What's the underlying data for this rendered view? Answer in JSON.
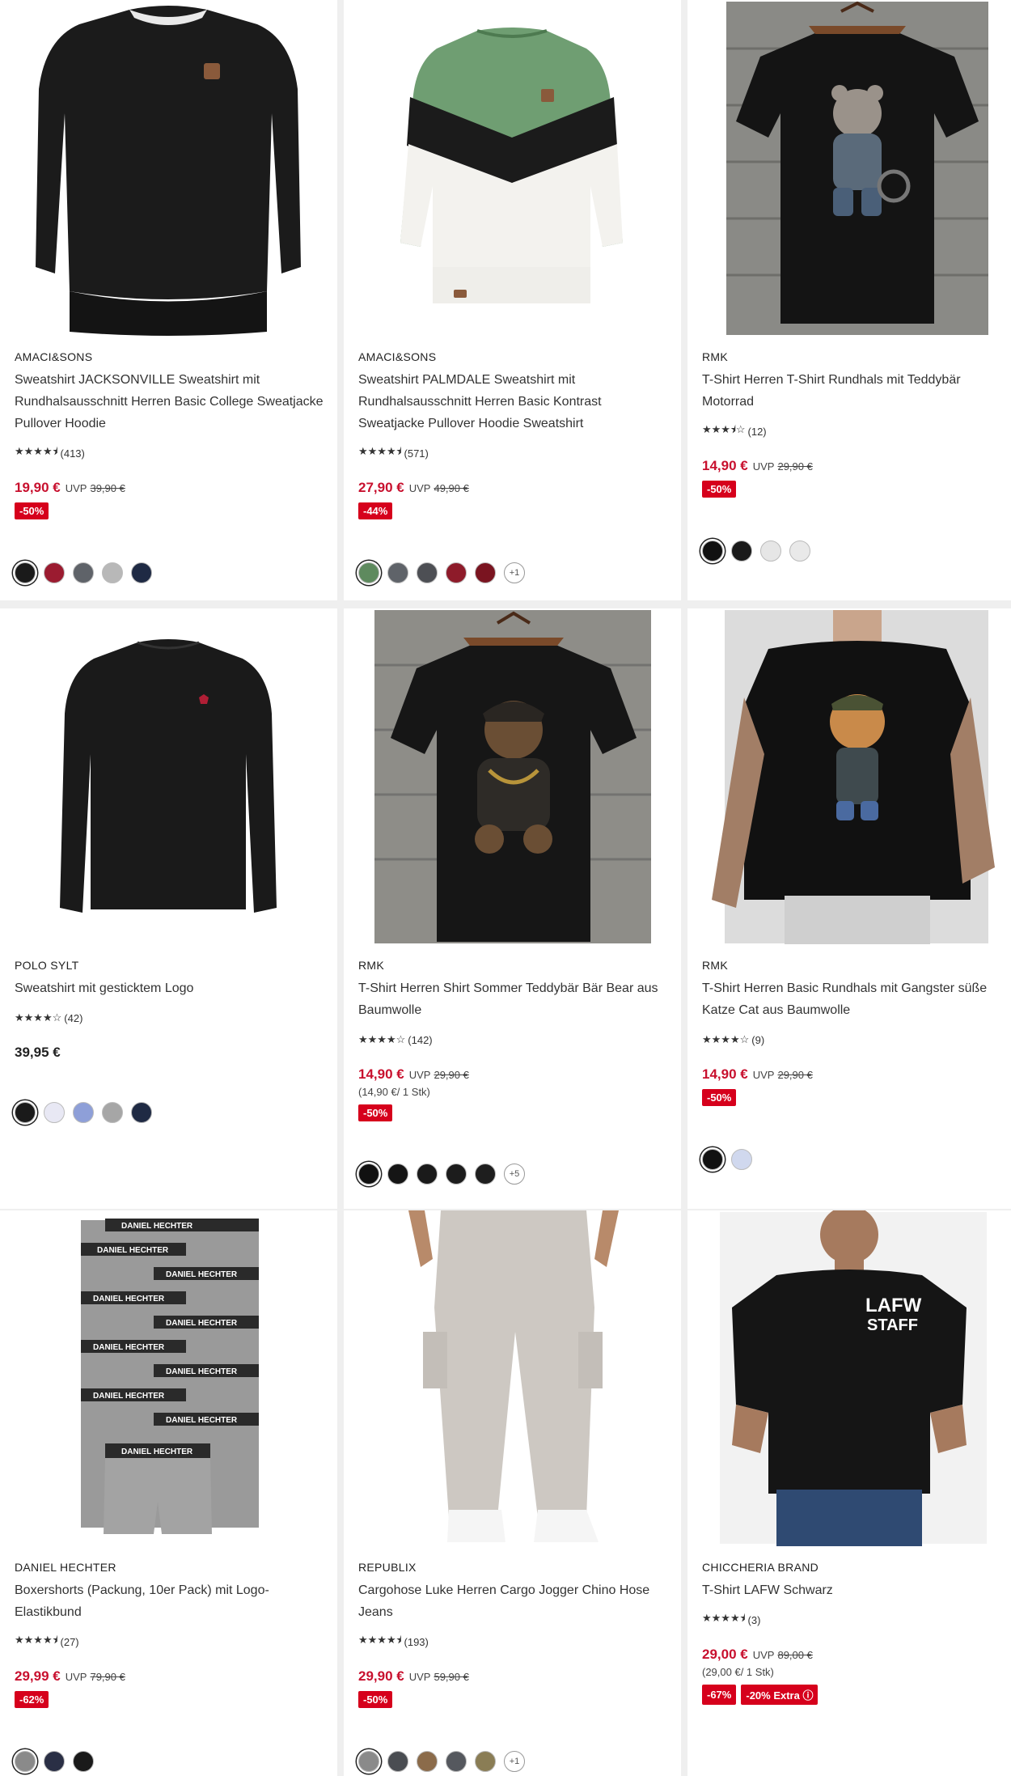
{
  "products": [
    {
      "brand": "AMACI&SONS",
      "title": "Sweatshirt JACKSONVILLE Sweatshirt mit Rundhalsausschnitt Herren Basic College Sweatjacke Pullover Hoodie",
      "rating": 4.5,
      "stars": "★★★★⯨",
      "reviews": "(413)",
      "price": "19,90 €",
      "uvp": "UVP",
      "old_price": "39,90 €",
      "badges": [
        "-50%"
      ],
      "swatches": [
        "#1a1a1a",
        "#9b1b30",
        "#5f6369",
        "#b8b8b8",
        "#1f2a44"
      ],
      "more": "",
      "image": "black-sweatshirt-leather-patch"
    },
    {
      "brand": "AMACI&SONS",
      "title": "Sweatshirt PALMDALE Sweatshirt mit Rundhalsausschnitt Herren Basic Kontrast Sweatjacke Pullover Hoodie Sweatshirt",
      "rating": 4.5,
      "stars": "★★★★⯨",
      "reviews": "(571)",
      "price": "27,90 €",
      "uvp": "UVP",
      "old_price": "49,90 €",
      "badges": [
        "-44%"
      ],
      "swatches": [
        "#5e8a5e",
        "#5f6369",
        "#4d4f54",
        "#8e1b2a",
        "#7a1420"
      ],
      "more": "+1",
      "image": "green-black-white-colorblock-sweatshirt"
    },
    {
      "brand": "RMK",
      "title": "T-Shirt Herren T-Shirt Rundhals mit Teddybär Motorrad",
      "rating": 3.5,
      "stars": "★★★⯨☆",
      "reviews": "(12)",
      "price": "14,90 €",
      "uvp": "UVP",
      "old_price": "29,90 €",
      "badges": [
        "-50%"
      ],
      "swatches": [
        "#111111",
        "#1a1a1a",
        "#e6e6e6",
        "#e9e9e9"
      ],
      "more": "",
      "image": "black-tshirt-teddy-motorcycle"
    },
    {
      "brand": "POLO SYLT",
      "title": "Sweatshirt mit gesticktem Logo",
      "rating": 4.0,
      "stars": "★★★★☆",
      "reviews": "(42)",
      "price": "39,95 €",
      "uvp": "",
      "old_price": "",
      "badges": [],
      "swatches": [
        "#1a1a1a",
        "#e8e8f4",
        "#8e9fd8",
        "#a6a6a6",
        "#1f2a44"
      ],
      "more": "",
      "image": "black-sweatshirt-embroidered-logo"
    },
    {
      "brand": "RMK",
      "title": "T-Shirt Herren Shirt Sommer Teddybär Bär Bear aus Baumwolle",
      "rating": 4.0,
      "stars": "★★★★☆",
      "reviews": "(142)",
      "price": "14,90 €",
      "uvp": "UVP",
      "old_price": "29,90 €",
      "unit": "(14,90 €/ 1 Stk)",
      "badges": [
        "-50%"
      ],
      "swatches": [
        "#111111",
        "#151515",
        "#1a1a1a",
        "#1c1c1c",
        "#1e1e1e"
      ],
      "more": "+5",
      "image": "black-tshirt-teddy-gold-chain"
    },
    {
      "brand": "RMK",
      "title": "T-Shirt Herren Basic Rundhals mit Gangster süße Katze Cat aus Baumwolle",
      "rating": 4.0,
      "stars": "★★★★☆",
      "reviews": "(9)",
      "price": "14,90 €",
      "uvp": "UVP",
      "old_price": "29,90 €",
      "badges": [
        "-50%"
      ],
      "swatches": [
        "#111111",
        "#d0d8ee"
      ],
      "more": "",
      "image": "model-black-tshirt-cat-print"
    },
    {
      "brand": "DANIEL HECHTER",
      "title": "Boxershorts (Packung, 10er Pack) mit Logo-Elastikbund",
      "rating": 4.5,
      "stars": "★★★★⯨",
      "reviews": "(27)",
      "price": "29,99 €",
      "uvp": "UVP",
      "old_price": "79,90 €",
      "badges": [
        "-62%"
      ],
      "swatches": [
        "#8a8a8a",
        "#2a2f45",
        "#1a1a1a"
      ],
      "more": "",
      "image": "grey-boxershorts-10-pack",
      "waistband_text": "DANIEL HECHTER"
    },
    {
      "brand": "REPUBLIX",
      "title": "Cargohose Luke Herren Cargo Jogger Chino Hose Jeans",
      "rating": 4.5,
      "stars": "★★★★⯨",
      "reviews": "(193)",
      "price": "29,90 €",
      "uvp": "UVP",
      "old_price": "59,90 €",
      "badges": [
        "-50%"
      ],
      "swatches": [
        "#8a8a8a",
        "#4a4d52",
        "#8b6b4a",
        "#55585e",
        "#8a7d55"
      ],
      "more": "+1",
      "image": "beige-cargo-jogger-pants"
    },
    {
      "brand": "CHICCHERIA BRAND",
      "title": "T-Shirt LAFW Schwarz",
      "rating": 4.5,
      "stars": "★★★★⯨",
      "reviews": "(3)",
      "price": "29,00 €",
      "uvp": "UVP",
      "old_price": "89,00 €",
      "unit": "(29,00 €/ 1 Stk)",
      "badges": [
        "-67%",
        "-20% Extra ⓘ"
      ],
      "swatches": [],
      "more": "",
      "image": "model-black-tshirt-lafw-staff",
      "print_text_1": "LAFW",
      "print_text_2": "STAFF"
    }
  ]
}
